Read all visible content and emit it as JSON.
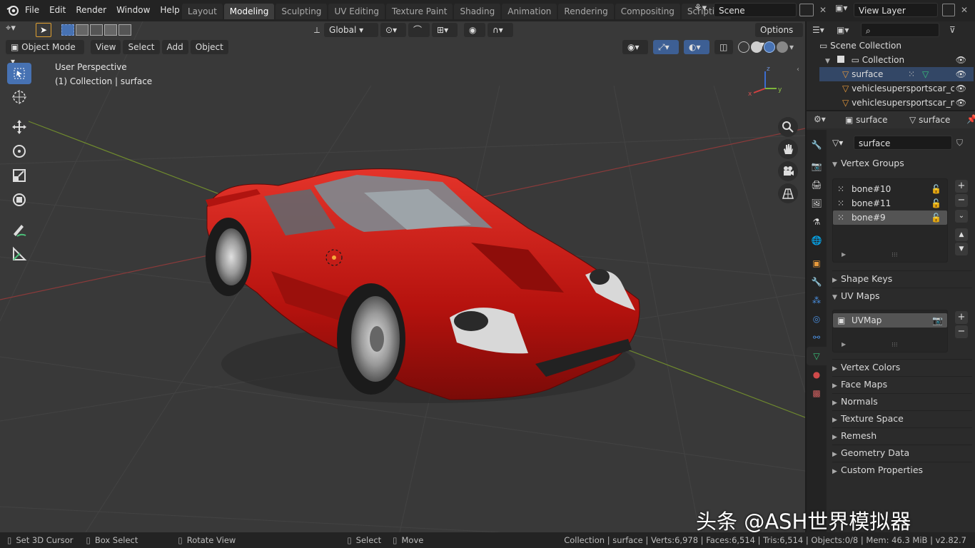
{
  "topbar": {
    "menus": [
      "File",
      "Edit",
      "Render",
      "Window",
      "Help"
    ],
    "workspaces": [
      "Layout",
      "Modeling",
      "Sculpting",
      "UV Editing",
      "Texture Paint",
      "Shading",
      "Animation",
      "Rendering",
      "Compositing",
      "Scripting"
    ],
    "active_workspace": "Modeling",
    "scene": "Scene",
    "view_layer": "View Layer"
  },
  "viewport": {
    "transform_orientation": "Global",
    "options_label": "Options",
    "mode": "Object Mode",
    "header_menus": [
      "View",
      "Select",
      "Add",
      "Object"
    ],
    "overlay_line1": "User Perspective",
    "overlay_line2": "(1) Collection | surface",
    "gizmo_x": "x",
    "gizmo_y": "y",
    "gizmo_z": "z"
  },
  "outliner": {
    "scene_collection": "Scene Collection",
    "collection": "Collection",
    "objects": [
      "surface",
      "vehiclesupersportscar_ch",
      "vehiclesupersportscar_m"
    ]
  },
  "properties": {
    "object_name": "surface",
    "data_name": "surface",
    "mesh_name": "surface",
    "panels": {
      "vertex_groups": "Vertex Groups",
      "shape_keys": "Shape Keys",
      "uv_maps": "UV Maps",
      "vertex_colors": "Vertex Colors",
      "face_maps": "Face Maps",
      "normals": "Normals",
      "texture_space": "Texture Space",
      "remesh": "Remesh",
      "geometry_data": "Geometry Data",
      "custom_properties": "Custom Properties"
    },
    "vertex_groups": [
      "bone#10",
      "bone#11",
      "bone#9"
    ],
    "uv_maps": [
      "UVMap"
    ]
  },
  "statusbar": {
    "hint1": "Set 3D Cursor",
    "hint2": "Box Select",
    "hint3": "Rotate View",
    "hint4": "Select",
    "hint5": "Move",
    "stats": "Collection | surface | Verts:6,978 | Faces:6,514 | Tris:6,514 | Objects:0/8 | Mem: 46.3 MiB | v2.82.7"
  },
  "watermark": "头条 @ASH世界模拟器",
  "colors": {
    "accent": "#4772b3",
    "car_red": "#c8140f",
    "mesh_green": "#39c47a",
    "object_orange": "#e89a3c"
  },
  "icons": [
    "blender-logo-icon",
    "select-tool-icon",
    "cursor-icon",
    "move-icon",
    "rotate-icon",
    "scale-icon",
    "transform-icon",
    "annotate-icon",
    "measure-icon",
    "zoom-icon",
    "hand-icon",
    "camera-icon",
    "grid-icon",
    "eye-icon",
    "mesh-data-icon",
    "plus-icon",
    "minus-icon"
  ]
}
